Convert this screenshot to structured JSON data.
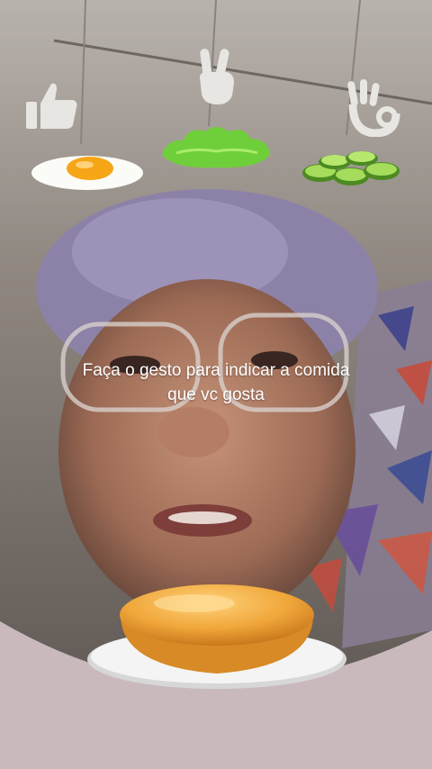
{
  "overlay": {
    "prompt_line1": "Faça o gesto para indicar a comida",
    "prompt_line2": "que vc gosta"
  },
  "gestures": [
    {
      "icon": "thumbs-up-icon",
      "food": "fried-egg"
    },
    {
      "icon": "peace-sign-icon",
      "food": "lettuce"
    },
    {
      "icon": "ok-hand-icon",
      "food": "cucumber-slices"
    }
  ],
  "colors": {
    "prompt_text": "#ffffff",
    "gesture_icon": "#e8e6e2",
    "bun": "#f0a63a",
    "plate": "#f4f4f4",
    "lettuce": "#6fcf3a",
    "cucumber": "#8fd04a",
    "egg_yolk": "#f7a617"
  }
}
